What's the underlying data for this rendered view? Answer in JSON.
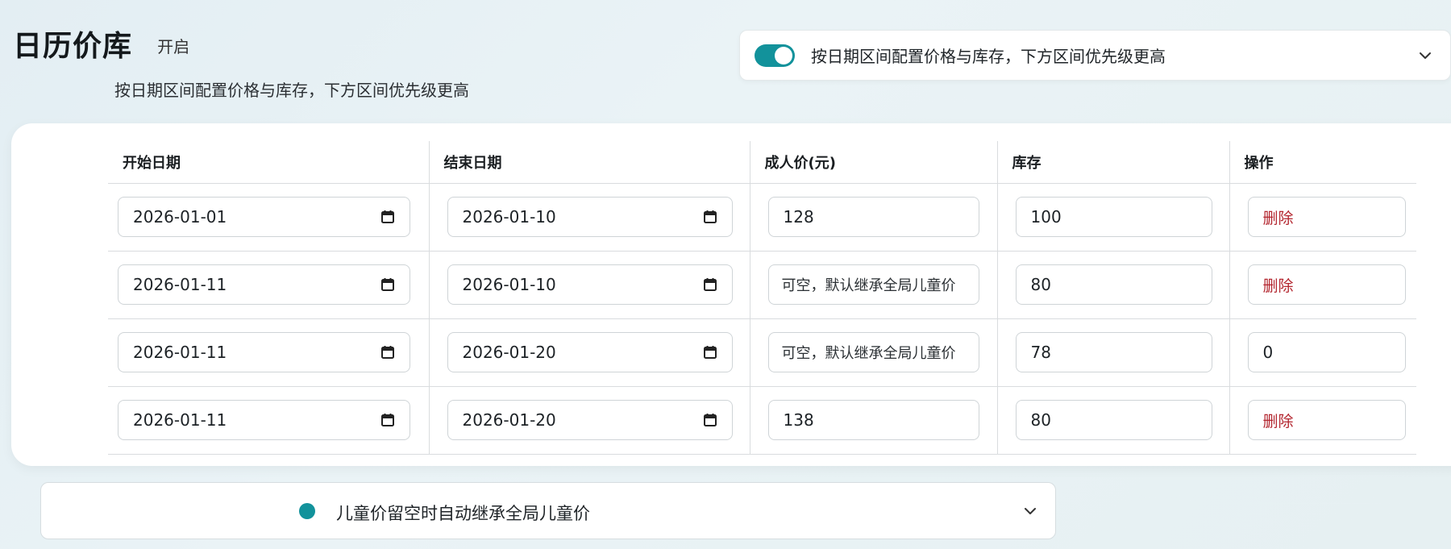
{
  "header": {
    "title": "日历价库",
    "status": "开启",
    "subtitle": "按日期区间配置价格与库存，下方区间优先级更高"
  },
  "toggle_bar": {
    "enabled": true,
    "label": "按日期区间配置价格与库存，下方区间优先级更高",
    "accent_color": "#12929b"
  },
  "table": {
    "headers": [
      "开始日期",
      "结束日期",
      "成人价(元)",
      "库存",
      "操作"
    ],
    "rows": [
      {
        "start": "2026-01-01",
        "end": "2026-01-10",
        "price": "128",
        "price_is_placeholder": false,
        "stock": "100",
        "action": "删除"
      },
      {
        "start": "2026-01-11",
        "end": "2026-01-10",
        "price": "可空，默认继承全局儿童价",
        "price_is_placeholder": true,
        "stock": "80",
        "action": "删除"
      },
      {
        "start": "2026-01-11",
        "end": "2026-01-20",
        "price": "可空，默认继承全局儿童价",
        "price_is_placeholder": true,
        "stock": "78",
        "action": "0"
      },
      {
        "start": "2026-01-11",
        "end": "2026-01-20",
        "price": "138",
        "price_is_placeholder": false,
        "stock": "80",
        "action": "删除"
      }
    ]
  },
  "bottom_bar": {
    "label": "儿童价留空时自动继承全局儿童价"
  },
  "icons": {
    "date": "calendar-icon",
    "expand": "chevron-down-icon",
    "status": "dot-icon"
  }
}
